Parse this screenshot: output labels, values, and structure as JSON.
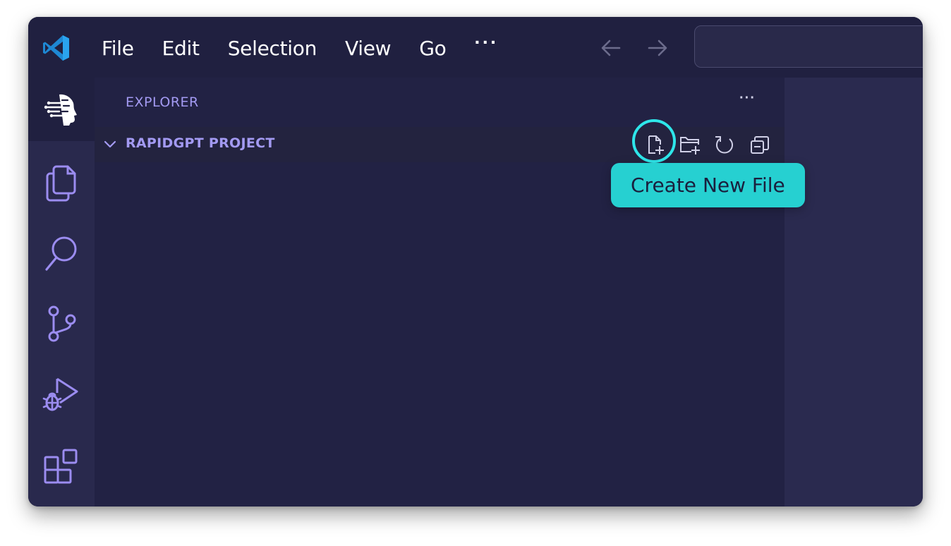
{
  "titlebar": {
    "app_icon": "vscode-logo-icon",
    "menu": [
      {
        "label": "File"
      },
      {
        "label": "Edit"
      },
      {
        "label": "Selection"
      },
      {
        "label": "View"
      },
      {
        "label": "Go"
      }
    ],
    "more_label": "···",
    "nav_back_icon": "arrow-left-icon",
    "nav_forward_icon": "arrow-right-icon",
    "search_value": ""
  },
  "activity_bar": {
    "items": [
      {
        "icon": "rapidgpt-logo-icon",
        "active": true
      },
      {
        "icon": "explorer-files-icon",
        "active": false
      },
      {
        "icon": "search-icon",
        "active": false
      },
      {
        "icon": "source-control-icon",
        "active": false
      },
      {
        "icon": "run-debug-icon",
        "active": false
      },
      {
        "icon": "extensions-icon",
        "active": false
      }
    ]
  },
  "sidebar": {
    "title": "EXPLORER",
    "more_label": "···",
    "section": {
      "label": "RAPIDGPT PROJECT",
      "expanded": true,
      "actions": [
        {
          "icon": "new-file-icon",
          "highlighted": true
        },
        {
          "icon": "new-folder-icon",
          "highlighted": false
        },
        {
          "icon": "refresh-icon",
          "highlighted": false
        },
        {
          "icon": "collapse-all-icon",
          "highlighted": false
        }
      ]
    }
  },
  "tooltip": {
    "text": "Create New File"
  },
  "colors": {
    "accent_text": "#a39af2",
    "highlight_ring": "#2ee6ea",
    "tooltip_bg": "#26d0d1",
    "icon_purple": "#9b8cf0"
  }
}
